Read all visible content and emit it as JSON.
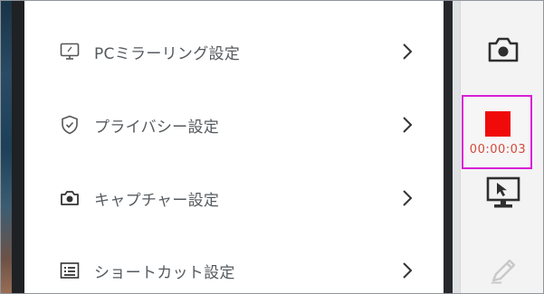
{
  "settings_menu": {
    "items": [
      {
        "label": "PCミラーリング設定",
        "icon": "monitor-icon"
      },
      {
        "label": "プライバシー設定",
        "icon": "shield-check-icon"
      },
      {
        "label": "キャプチャー設定",
        "icon": "camera-icon"
      },
      {
        "label": "ショートカット設定",
        "icon": "keyboard-list-icon"
      }
    ],
    "chevron_icon": "chevron-right-icon"
  },
  "toolbar": {
    "screenshot_icon": "camera-icon",
    "recording": {
      "stop_icon": "stop-icon",
      "elapsed": "00:00:03",
      "highlight_color": "#d81fd6",
      "stop_color": "#f00a0a"
    },
    "mirror_pointer_icon": "monitor-pointer-icon",
    "draw_icon": "pen-icon"
  }
}
